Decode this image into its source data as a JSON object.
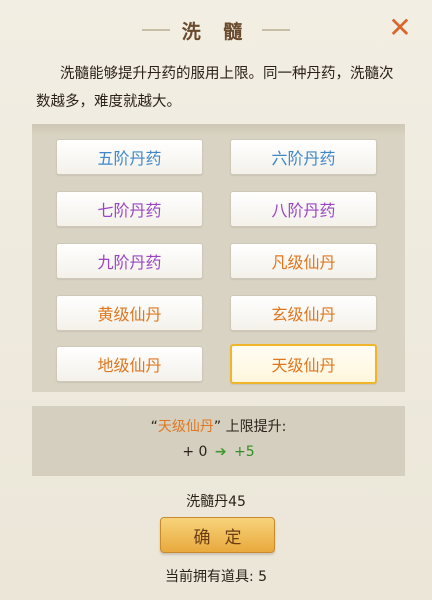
{
  "dialog": {
    "title": "洗 髓",
    "description": "洗髓能够提升丹药的服用上限。同一种丹药，洗髓次数越多，难度就越大。"
  },
  "grades": [
    {
      "label": "五阶丹药",
      "color": "#3f88c8"
    },
    {
      "label": "六阶丹药",
      "color": "#3f88c8"
    },
    {
      "label": "七阶丹药",
      "color": "#9a46c4"
    },
    {
      "label": "八阶丹药",
      "color": "#9a46c4"
    },
    {
      "label": "九阶丹药",
      "color": "#9a46c4"
    },
    {
      "label": "凡级仙丹",
      "color": "#e0771f"
    },
    {
      "label": "黄级仙丹",
      "color": "#e0771f"
    },
    {
      "label": "玄级仙丹",
      "color": "#e0771f"
    },
    {
      "label": "地级仙丹",
      "color": "#e0771f"
    },
    {
      "label": "天级仙丹",
      "color": "#e0771f"
    }
  ],
  "selected_grade": "天级仙丹",
  "info": {
    "quote_open": "“",
    "selected": "天级仙丹",
    "quote_close": "”",
    "suffix": "上限提升:",
    "from": "+ 0",
    "to": "+5"
  },
  "cost_text": "洗髓丹45",
  "confirm_label": "确定",
  "owned_text": "当前拥有道具: 5"
}
